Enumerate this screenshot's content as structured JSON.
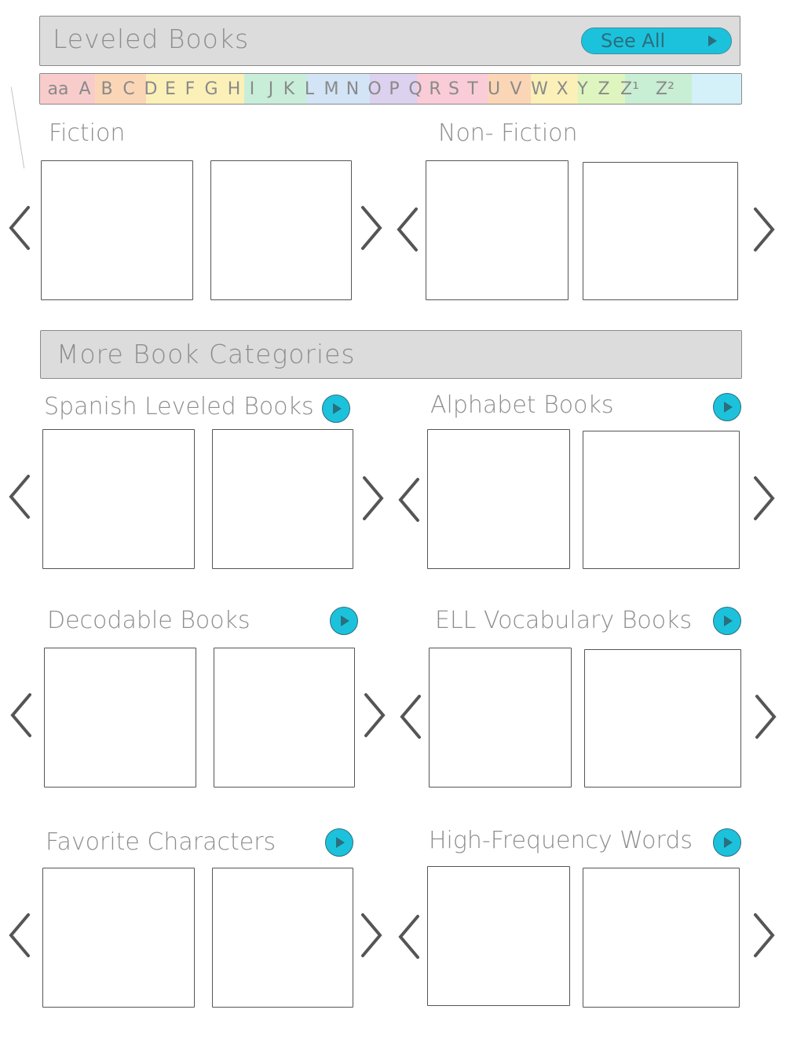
{
  "leveled_books": {
    "title": "Leveled Books",
    "see_all_label": "See All",
    "levels": [
      "aa",
      "A",
      "B",
      "C",
      "D",
      "E",
      "F",
      "G",
      "H",
      "I",
      "J",
      "K",
      "L",
      "M",
      "N",
      "O",
      "P",
      "Q",
      "R",
      "S",
      "T",
      "U",
      "V",
      "W",
      "X",
      "Y",
      "Z",
      "Z¹",
      "Z²"
    ],
    "level_colors": [
      "#f9cccc",
      "#fbd6b6",
      "#fbf0b8",
      "#d8f3c4",
      "#c8eeda",
      "#d2e4f6",
      "#dcd1ef",
      "#f9ccd8",
      "#fbd6b6",
      "#fbf0b8",
      "#dff5c0",
      "#c8eed4",
      "#d4f1f9"
    ]
  },
  "fiction": {
    "label": "Fiction"
  },
  "nonfiction": {
    "label": "Non- Fiction"
  },
  "more_categories": {
    "title": "More Book Categories"
  },
  "categories": [
    {
      "label": "Spanish Leveled Books"
    },
    {
      "label": "Alphabet Books"
    },
    {
      "label": "Decodable Books"
    },
    {
      "label": "ELL Vocabulary Books"
    },
    {
      "label": "Favorite Characters"
    },
    {
      "label": "High-Frequency Words"
    }
  ],
  "icons": {
    "prev": "chevron-left-icon",
    "next": "chevron-right-icon",
    "play": "play-icon"
  },
  "colors": {
    "bar_bg": "#dcdcdc",
    "accent": "#1cc2dc",
    "stroke": "#555555"
  }
}
